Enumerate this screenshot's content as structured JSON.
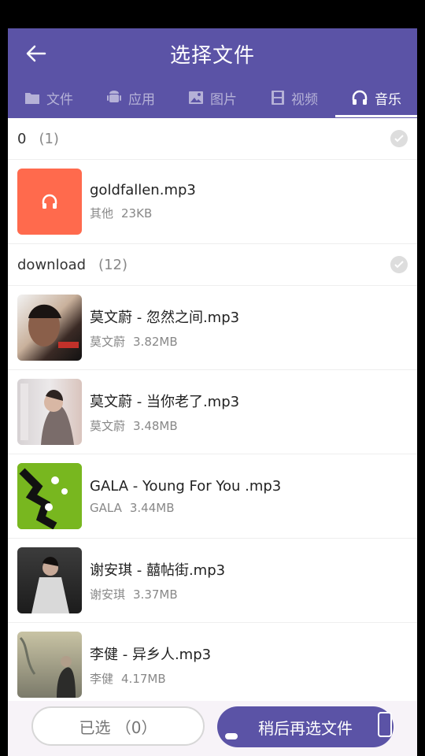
{
  "header": {
    "title": "选择文件",
    "tabs": [
      {
        "label": "文件",
        "icon": "folder-icon"
      },
      {
        "label": "应用",
        "icon": "android-icon"
      },
      {
        "label": "图片",
        "icon": "image-icon"
      },
      {
        "label": "视频",
        "icon": "video-icon"
      },
      {
        "label": "音乐",
        "icon": "headphones-icon"
      }
    ],
    "active_tab": "音乐"
  },
  "groups": [
    {
      "name": "0",
      "count": "(1)",
      "items": [
        {
          "name": "goldfallen.mp3",
          "artist": "其他",
          "size": "23KB",
          "thumb": "headphones-icon",
          "thumb_color": "#ff6a4d"
        }
      ]
    },
    {
      "name": "download",
      "count": "(12)",
      "items": [
        {
          "name": "莫文蔚 - 忽然之间.mp3",
          "artist": "莫文蔚",
          "size": "3.82MB"
        },
        {
          "name": "莫文蔚 - 当你老了.mp3",
          "artist": "莫文蔚",
          "size": "3.48MB"
        },
        {
          "name": "GALA - Young For You .mp3",
          "artist": "GALA",
          "size": "3.44MB"
        },
        {
          "name": "谢安琪 - 囍帖街.mp3",
          "artist": "谢安琪",
          "size": "3.37MB"
        },
        {
          "name": "李健 - 异乡人.mp3",
          "artist": "李健",
          "size": "4.17MB"
        }
      ]
    }
  ],
  "bottom": {
    "selected_label": "已选 （0）",
    "later_label": "稍后再选文件"
  },
  "colors": {
    "primary": "#5b53a6",
    "accent": "#ff6a4d"
  }
}
